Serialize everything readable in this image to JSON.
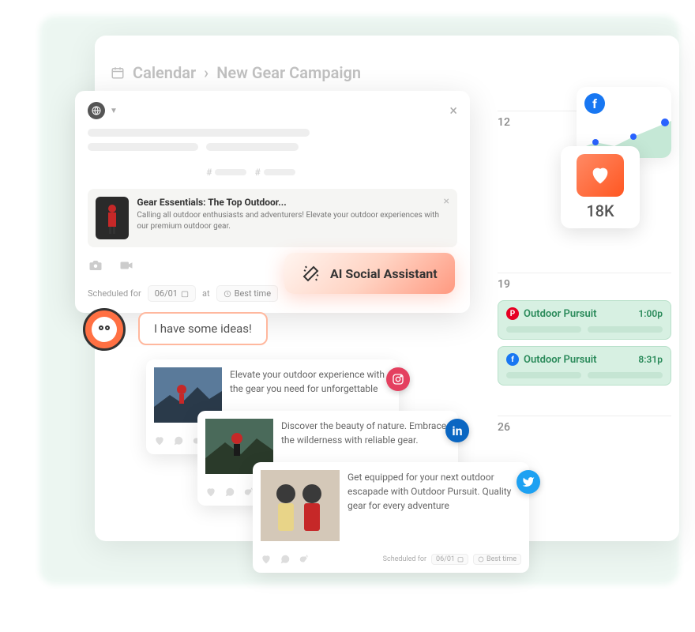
{
  "breadcrumb": {
    "root": "Calendar",
    "current": "New Gear Campaign"
  },
  "calendar": {
    "dates": {
      "d1": "12",
      "d2": "19",
      "d3": "26"
    },
    "events": [
      {
        "network": "pinterest",
        "title": "Outdoor Pursuit",
        "time": "1:00p"
      },
      {
        "network": "facebook",
        "title": "Outdoor Pursuit",
        "time": "8:31p"
      }
    ]
  },
  "stats": {
    "likes": "18K"
  },
  "compose": {
    "gear": {
      "title": "Gear Essentials: The Top Outdoor...",
      "body": "Calling all outdoor enthusiasts and adventurers! Elevate your outdoor experiences with our premium outdoor gear."
    },
    "schedule": {
      "label": "Scheduled for",
      "date": "06/01",
      "at": "at",
      "best": "Best time"
    }
  },
  "ai": {
    "badge": "AI Social Assistant",
    "bubble": "I have some ideas!"
  },
  "suggestions": [
    {
      "text": "Elevate your outdoor experience with the gear you need for unforgettable",
      "network": "instagram"
    },
    {
      "text": "Discover the beauty of nature. Embrace the wilderness with reliable gear.",
      "network": "linkedin"
    },
    {
      "text": "Get equipped for your next outdoor escapade with Outdoor Pursuit. Quality gear for every adventure",
      "network": "twitter"
    }
  ],
  "footer_schedule": {
    "label": "Scheduled for",
    "date": "06/01",
    "best": "Best time"
  },
  "chart_data": {
    "type": "area",
    "x": [
      0,
      1,
      2,
      3,
      4
    ],
    "values": [
      10,
      18,
      14,
      22,
      30
    ],
    "color": "#8fd4b4"
  }
}
